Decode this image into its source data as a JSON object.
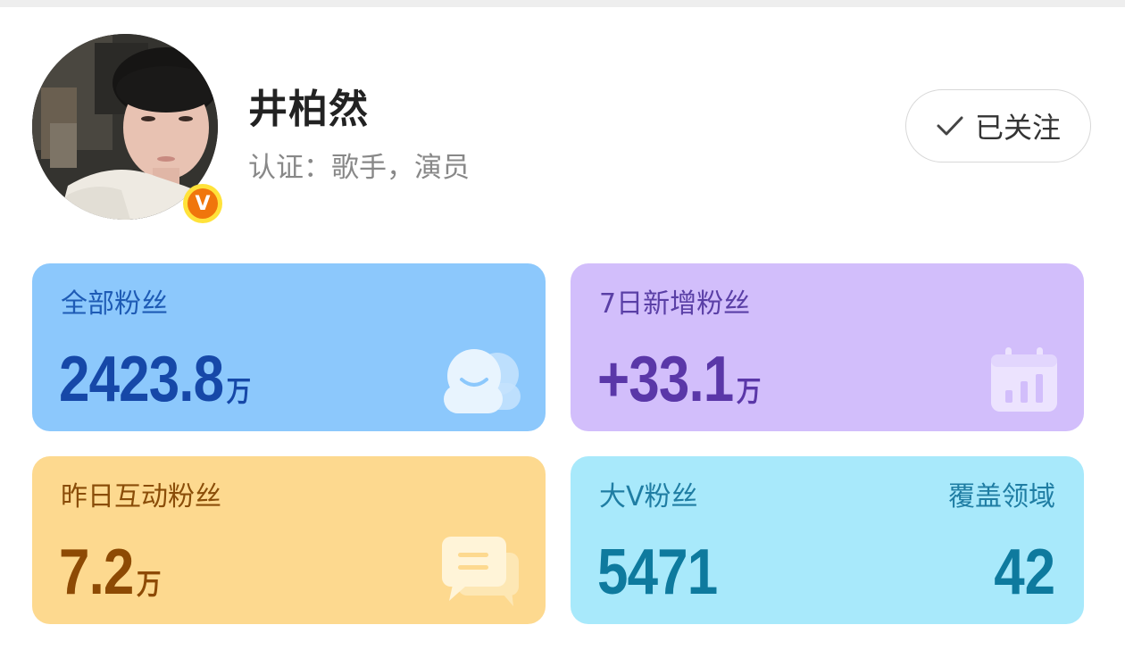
{
  "profile": {
    "name": "井柏然",
    "certification": "认证：歌手，演员",
    "verified_badge": "V"
  },
  "follow_button": {
    "label": "已关注",
    "icon": "check-icon"
  },
  "stats": {
    "all_fans": {
      "label": "全部粉丝",
      "value": "2423.8",
      "unit": "万",
      "icon": "fans-faces-icon"
    },
    "new_fans_7d": {
      "label": "7日新增粉丝",
      "value": "+33.1",
      "unit": "万",
      "icon": "calendar-chart-icon"
    },
    "interactive_fans_yesterday": {
      "label": "昨日互动粉丝",
      "value": "7.2",
      "unit": "万",
      "icon": "chat-bubbles-icon"
    },
    "big_v_fans": {
      "label": "大V粉丝",
      "value": "5471",
      "coverage_label": "覆盖领域",
      "coverage_value": "42"
    }
  },
  "colors": {
    "all_fans_bg": "#8cc8fc",
    "new_fans_bg": "#d2befb",
    "interactive_bg": "#fdd98f",
    "big_v_bg": "#a8e9fb",
    "badge_orange": "#f0760c",
    "badge_yellow": "#ffe23a"
  }
}
